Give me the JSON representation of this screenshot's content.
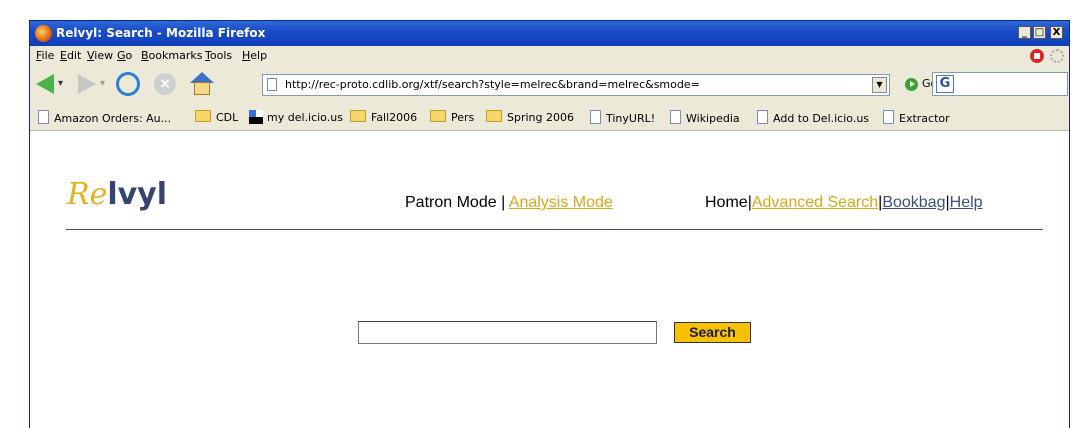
{
  "window": {
    "title": "Relvyl: Search - Mozilla Firefox",
    "controls": {
      "minimize": "_",
      "maximize": "□",
      "close": "X"
    }
  },
  "menu": [
    {
      "label": "File"
    },
    {
      "label": "Edit"
    },
    {
      "label": "View"
    },
    {
      "label": "Go"
    },
    {
      "label": "Bookmarks"
    },
    {
      "label": "Tools"
    },
    {
      "label": "Help"
    }
  ],
  "navbar": {
    "url": "http://rec-proto.cdlib.org/xtf/search?style=melrec&brand=melrec&smode=",
    "go_label": "Go",
    "search_engine_glyph": "G",
    "icons": [
      "back-arrow-icon",
      "forward-arrow-icon",
      "reload-icon",
      "stop-icon",
      "home-icon"
    ]
  },
  "bookmarks": [
    {
      "label": "Amazon Orders: Au...",
      "icon": "page-icon"
    },
    {
      "label": "CDL",
      "icon": "folder-icon"
    },
    {
      "label": "my del.icio.us",
      "icon": "delicious-icon"
    },
    {
      "label": "Fall2006",
      "icon": "folder-icon"
    },
    {
      "label": "Pers",
      "icon": "folder-icon"
    },
    {
      "label": "Spring 2006",
      "icon": "folder-icon"
    },
    {
      "label": "TinyURL!",
      "icon": "page-icon"
    },
    {
      "label": "Wikipedia",
      "icon": "page-icon"
    },
    {
      "label": "Add to Del.icio.us",
      "icon": "page-icon"
    },
    {
      "label": "Extractor",
      "icon": "page-icon"
    }
  ],
  "page": {
    "logo": {
      "part1": "Re",
      "part2": "lvyl"
    },
    "mode_nav": {
      "patron": "Patron Mode",
      "separator": "|",
      "analysis": "Analysis Mode"
    },
    "site_nav": {
      "home": "Home",
      "advanced_search": "Advanced Search",
      "bookbag": "Bookbag",
      "help": "Help",
      "separator": "|"
    },
    "search": {
      "query_value": "",
      "button_label": "Search"
    }
  },
  "colors": {
    "titlebar": "#1b4bc8",
    "logo_gold": "#e6b120",
    "logo_navy": "#35456e",
    "link_gold": "#e0a618",
    "link_blue": "#3a4f87",
    "search_button": "#f7c000"
  }
}
